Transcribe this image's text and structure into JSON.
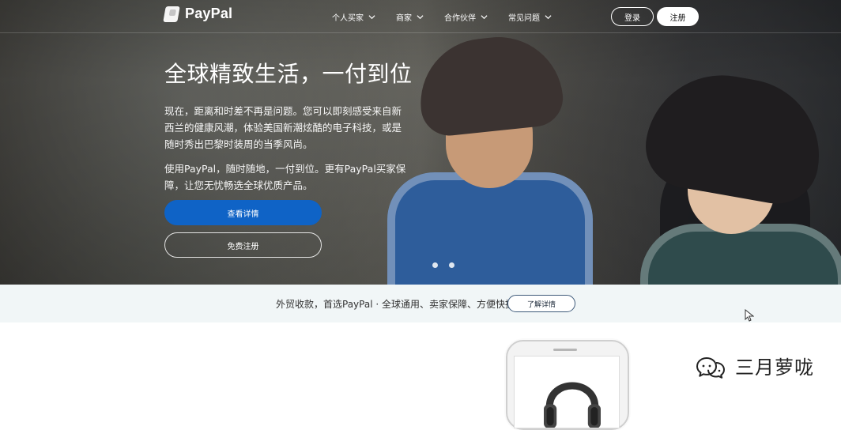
{
  "brand": {
    "name": "PayPal"
  },
  "nav": {
    "items": [
      {
        "label": "个人买家"
      },
      {
        "label": "商家"
      },
      {
        "label": "合作伙伴"
      },
      {
        "label": "常见问题"
      }
    ],
    "login_label": "登录",
    "register_label": "注册"
  },
  "hero": {
    "title": "全球精致生活，一付到位",
    "para1_line1": "现在，距离和时差不再是问题。您可以即刻感受来自新",
    "para1_line2": "西兰的健康风潮，体验美国新潮炫酷的电子科技，或是",
    "para1_line3": "随时秀出巴黎时装周的当季风尚。",
    "para2_line1": "使用PayPal，随时随地，一付到位。更有PayPal买家保",
    "para2_line2": "障，让您无忧畅选全球优质产品。",
    "primary_cta": "查看详情",
    "secondary_cta": "免费注册"
  },
  "carousel": {
    "active_index": 0,
    "count": 2
  },
  "promo": {
    "text": "外贸收款，首选PayPal · 全球通用、卖家保障、方便快捷",
    "button": "了解详情"
  },
  "watermark": {
    "text": "三月萝咙"
  },
  "colors": {
    "primary_blue": "#0f63c6",
    "promo_bg": "#f1f6f7"
  }
}
